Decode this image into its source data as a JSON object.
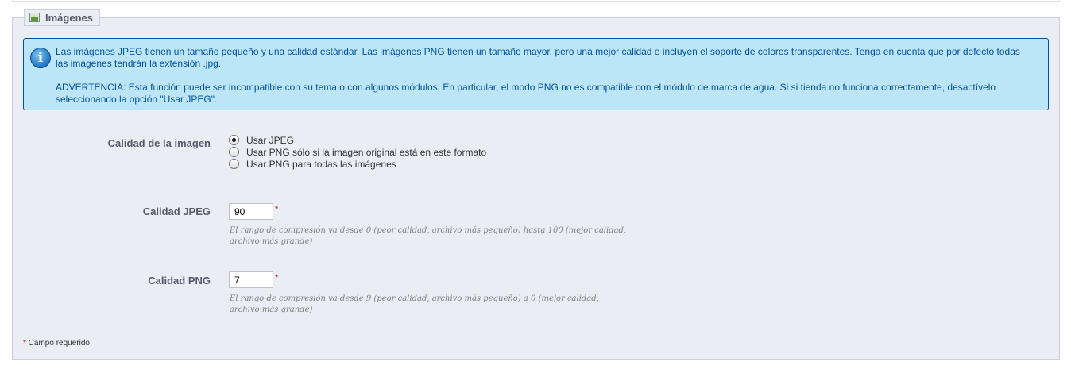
{
  "section": {
    "title": "Imágenes",
    "icon": "image-icon"
  },
  "info": {
    "icon": "info-icon",
    "paragraph1": "Las imágenes JPEG tienen un tamaño pequeño y una calidad estándar. Las imágenes PNG tienen un tamaño mayor, pero una mejor calidad e incluyen el soporte de colores transparentes. Tenga en cuenta que por defecto todas las imágenes tendrán la extensión .jpg.",
    "paragraph2": "ADVERTENCIA: Esta función puede ser incompatible con su tema o con algunos módulos. En particular, el modo PNG no es compatible con el módulo de marca de agua. Si si tienda no funciona correctamente, desactívelo seleccionando la opción \"Usar JPEG\"."
  },
  "image_quality": {
    "label": "Calidad de la imagen",
    "options": [
      {
        "label": "Usar JPEG",
        "checked": true
      },
      {
        "label": "Usar PNG sólo si la imagen original está en este formato",
        "checked": false
      },
      {
        "label": "Usar PNG para todas las imágenes",
        "checked": false
      }
    ]
  },
  "jpeg_quality": {
    "label": "Calidad JPEG",
    "value": "90",
    "required_mark": "*",
    "hint": "El rango de compresión va desde 0 (peor calidad, archivo más pequeño) hasta 100 (mejor calidad, archivo más grande)"
  },
  "png_quality": {
    "label": "Calidad PNG",
    "value": "7",
    "required_mark": "*",
    "hint": "El rango de compresión va desde 9 (peor calidad, archivo más pequeño) a 0 (mejor calidad, archivo más grande)"
  },
  "required_note": {
    "star": "*",
    "text": " Campo requerido"
  },
  "colors": {
    "info_background": "#bde5f8",
    "info_text": "#00529b",
    "panel_background": "#ebedf4",
    "required": "#cc0000"
  }
}
